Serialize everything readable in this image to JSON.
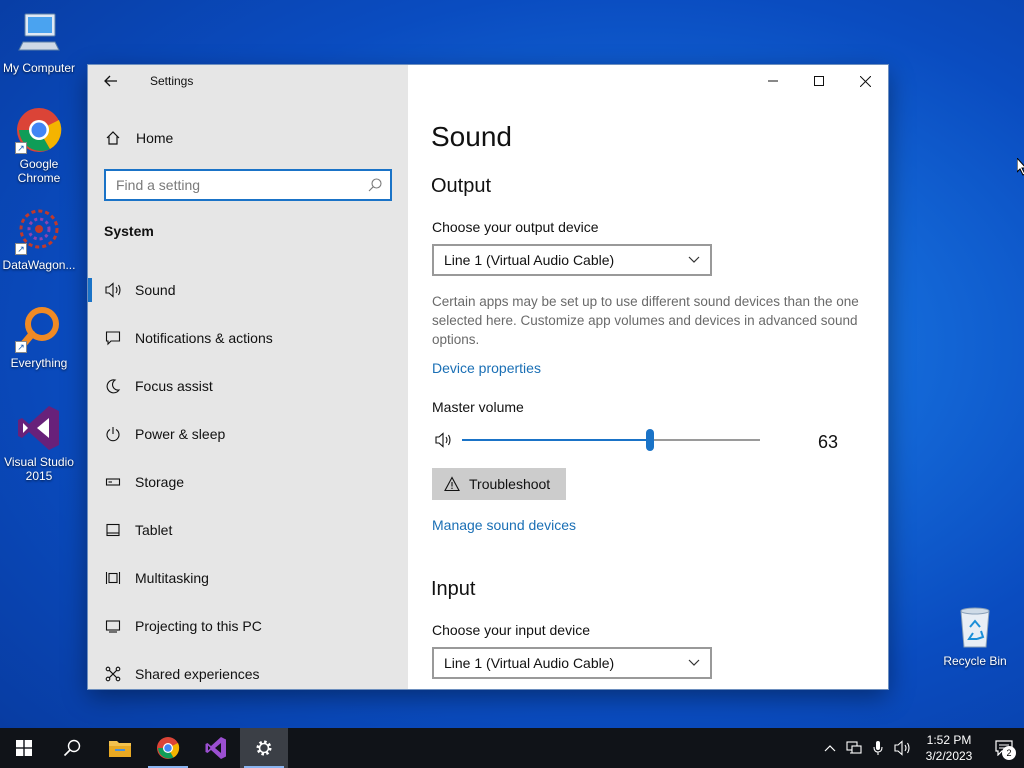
{
  "desktop": {
    "icons": [
      {
        "label": "My Computer"
      },
      {
        "label": "Google Chrome"
      },
      {
        "label": "DataWagon..."
      },
      {
        "label": "Everything"
      },
      {
        "label": "Visual Studio 2015"
      },
      {
        "label": "Recycle Bin"
      }
    ]
  },
  "window": {
    "title": "Settings",
    "sidebar": {
      "home_label": "Home",
      "search_placeholder": "Find a setting",
      "section_label": "System",
      "items": [
        {
          "label": "Sound",
          "icon": "speaker-icon",
          "active": true
        },
        {
          "label": "Notifications & actions",
          "icon": "notification-icon"
        },
        {
          "label": "Focus assist",
          "icon": "moon-icon"
        },
        {
          "label": "Power & sleep",
          "icon": "power-icon"
        },
        {
          "label": "Storage",
          "icon": "storage-icon"
        },
        {
          "label": "Tablet",
          "icon": "tablet-icon"
        },
        {
          "label": "Multitasking",
          "icon": "multitasking-icon"
        },
        {
          "label": "Projecting to this PC",
          "icon": "projector-icon"
        },
        {
          "label": "Shared experiences",
          "icon": "share-icon"
        }
      ]
    },
    "content": {
      "page_title": "Sound",
      "output": {
        "heading": "Output",
        "device_label": "Choose your output device",
        "device_value": "Line 1 (Virtual Audio Cable)",
        "help_text": "Certain apps may be set up to use different sound devices than the one selected here. Customize app volumes and devices in advanced sound options.",
        "device_properties_link": "Device properties",
        "master_volume_label": "Master volume",
        "volume_value": "63",
        "troubleshoot_label": "Troubleshoot",
        "manage_link": "Manage sound devices"
      },
      "input": {
        "heading": "Input",
        "device_label": "Choose your input device",
        "device_value": "Line 1 (Virtual Audio Cable)"
      }
    }
  },
  "taskbar": {
    "time": "1:52 PM",
    "date": "3/2/2023",
    "notification_count": "2"
  },
  "colors": {
    "accent": "#1a73c7",
    "sidebar_bg": "#e6e6e6",
    "link": "#1a6fb5",
    "taskbar": "#101318"
  }
}
